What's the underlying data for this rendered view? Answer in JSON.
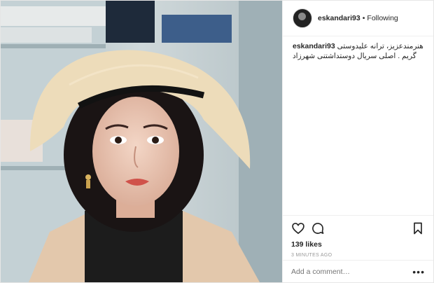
{
  "post": {
    "username": "eskandari93",
    "separator": "•",
    "follow_status": "Following",
    "caption_text": "هنرمندعزیز، ترانه علیدوستی گریم . اصلی سریال دوستداشتنی شهرزاد",
    "likes": "139 likes",
    "timestamp": "3 MINUTES AGO",
    "comment_placeholder": "Add a comment…",
    "more_label": "•••"
  },
  "icons": [
    "heart-icon",
    "comment-icon",
    "bookmark-icon",
    "more-options-icon"
  ]
}
